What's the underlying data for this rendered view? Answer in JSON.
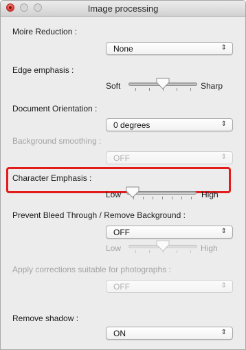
{
  "window": {
    "title": "Image processing"
  },
  "moire_reduction": {
    "label": "Moire Reduction :",
    "value": "None"
  },
  "edge_emphasis": {
    "label": "Edge emphasis :",
    "low": "Soft",
    "high": "Sharp",
    "level": 0.5
  },
  "document_orientation": {
    "label": "Document Orientation :",
    "value": "0 degrees"
  },
  "background_smoothing": {
    "label": "Background smoothing :",
    "value": "OFF",
    "enabled": false
  },
  "character_emphasis": {
    "label": "Character Emphasis :",
    "low": "Low",
    "high": "High",
    "level": 0.0,
    "highlight_color": "#e31b1b"
  },
  "bleed_through": {
    "label": "Prevent Bleed Through / Remove Background :",
    "value": "OFF",
    "low": "Low",
    "high": "High",
    "level": 0.5,
    "slider_enabled": false
  },
  "photo_corrections": {
    "label": "Apply corrections suitable for photographs :",
    "value": "OFF",
    "enabled": false
  },
  "remove_shadow": {
    "label": "Remove shadow :",
    "value": "ON"
  },
  "icons": {
    "dropdown": "up-down-arrows-icon",
    "window_close": "close-icon"
  }
}
